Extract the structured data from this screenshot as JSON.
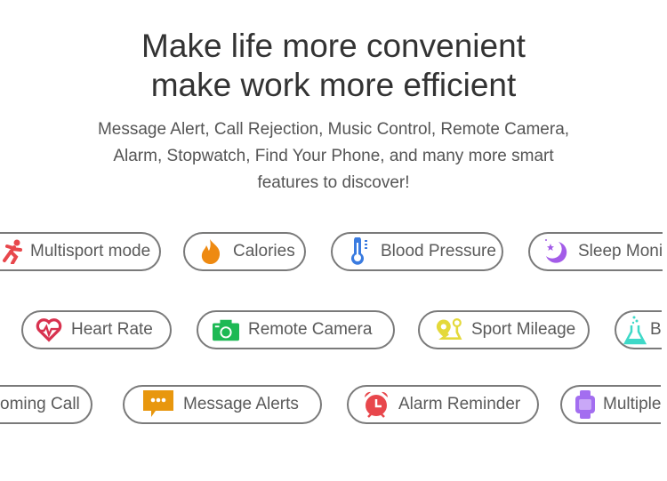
{
  "headline": {
    "line1": "Make life more convenient",
    "line2": "make work more efficient"
  },
  "subtitle": {
    "line1": "Message Alert, Call Rejection, Music Control, Remote Camera,",
    "line2": "Alarm, Stopwatch, Find Your Phone, and many more smart",
    "line3": "features to discover!"
  },
  "features": [
    {
      "label": "Multisport mode",
      "icon": "running-person-icon",
      "color": "#e8474c"
    },
    {
      "label": "Calories",
      "icon": "flame-icon",
      "color": "#ee8a12"
    },
    {
      "label": "Blood Pressure",
      "icon": "thermometer-icon",
      "color": "#3a7be0"
    },
    {
      "label": "Sleep Moni",
      "icon": "moon-star-icon",
      "color": "#a35ce8"
    },
    {
      "label": "Heart Rate",
      "icon": "heart-pulse-icon",
      "color": "#d8324f"
    },
    {
      "label": "Remote Camera",
      "icon": "camera-icon",
      "color": "#1db954"
    },
    {
      "label": "Sport Mileage",
      "icon": "map-pin-icon",
      "color": "#e4d93a"
    },
    {
      "label": "B",
      "icon": "flask-icon",
      "color": "#3fd9c8"
    },
    {
      "label": "oming Call",
      "icon": "",
      "color": ""
    },
    {
      "label": "Message Alerts",
      "icon": "message-bubble-icon",
      "color": "#e8970e"
    },
    {
      "label": "Alarm Reminder",
      "icon": "alarm-clock-icon",
      "color": "#e8474c"
    },
    {
      "label": "Multiple",
      "icon": "smartwatch-icon",
      "color": "#a36ef0"
    }
  ]
}
